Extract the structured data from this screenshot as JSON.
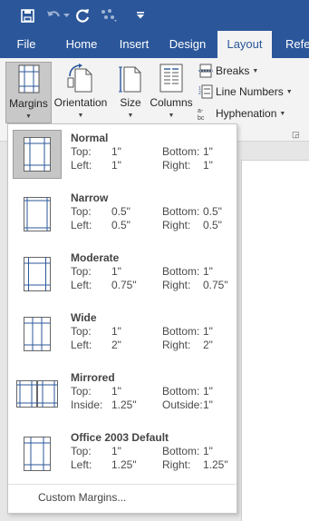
{
  "quick_access": {
    "icons": [
      "save-icon",
      "undo-icon",
      "redo-icon",
      "touch-mode-icon",
      "customize-qat-icon"
    ]
  },
  "tabs": [
    {
      "label": "File",
      "active": false
    },
    {
      "label": "Home",
      "active": false
    },
    {
      "label": "Insert",
      "active": false
    },
    {
      "label": "Design",
      "active": false
    },
    {
      "label": "Layout",
      "active": true
    },
    {
      "label": "Refe",
      "active": false
    }
  ],
  "ribbon": {
    "margins_label": "Margins",
    "orientation_label": "Orientation",
    "size_label": "Size",
    "columns_label": "Columns",
    "breaks_label": "Breaks",
    "line_numbers_label": "Line Numbers",
    "hyphenation_label": "Hyphenation"
  },
  "margins_menu": {
    "items": [
      {
        "name": "Normal",
        "row1": [
          "Top:",
          "1\"",
          "Bottom:",
          "1\""
        ],
        "row2": [
          "Left:",
          "1\"",
          "Right:",
          "1\""
        ],
        "selected": true
      },
      {
        "name": "Narrow",
        "row1": [
          "Top:",
          "0.5\"",
          "Bottom:",
          "0.5\""
        ],
        "row2": [
          "Left:",
          "0.5\"",
          "Right:",
          "0.5\""
        ],
        "selected": false
      },
      {
        "name": "Moderate",
        "row1": [
          "Top:",
          "1\"",
          "Bottom:",
          "1\""
        ],
        "row2": [
          "Left:",
          "0.75\"",
          "Right:",
          "0.75\""
        ],
        "selected": false
      },
      {
        "name": "Wide",
        "row1": [
          "Top:",
          "1\"",
          "Bottom:",
          "1\""
        ],
        "row2": [
          "Left:",
          "2\"",
          "Right:",
          "2\""
        ],
        "selected": false
      },
      {
        "name": "Mirrored",
        "row1": [
          "Top:",
          "1\"",
          "Bottom:",
          "1\""
        ],
        "row2": [
          "Inside:",
          "1.25\"",
          "Outside:",
          "1\""
        ],
        "selected": false
      },
      {
        "name": "Office 2003 Default",
        "row1": [
          "Top:",
          "1\"",
          "Bottom:",
          "1\""
        ],
        "row2": [
          "Left:",
          "1.25\"",
          "Right:",
          "1.25\""
        ],
        "selected": false
      }
    ],
    "custom_label": "Custom Margins..."
  },
  "colors": {
    "brand": "#2b579a",
    "accent_lines": "#2b579a"
  }
}
